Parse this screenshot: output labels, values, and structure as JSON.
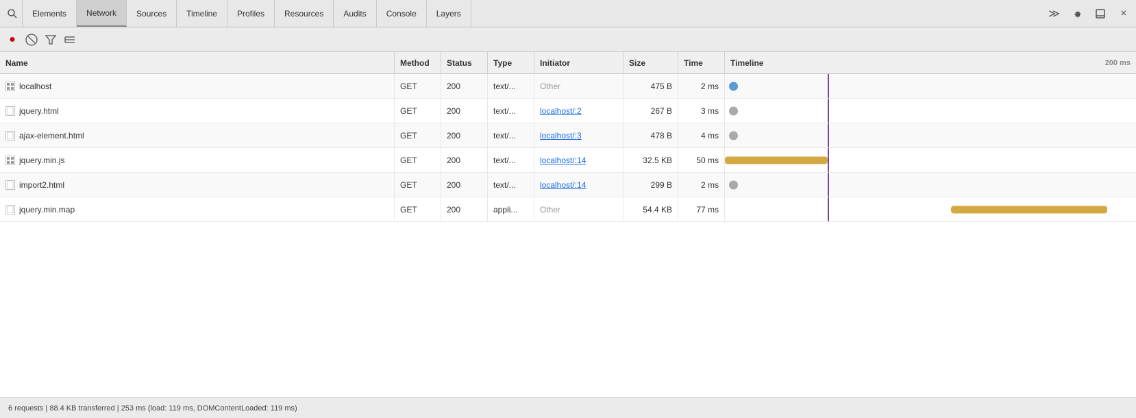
{
  "nav": {
    "tabs": [
      {
        "label": "Elements",
        "active": false
      },
      {
        "label": "Network",
        "active": true
      },
      {
        "label": "Sources",
        "active": false
      },
      {
        "label": "Timeline",
        "active": false
      },
      {
        "label": "Profiles",
        "active": false
      },
      {
        "label": "Resources",
        "active": false
      },
      {
        "label": "Audits",
        "active": false
      },
      {
        "label": "Console",
        "active": false
      },
      {
        "label": "Layers",
        "active": false
      }
    ],
    "right_icons": [
      "≫",
      "⚙",
      "▢",
      "×"
    ]
  },
  "toolbar": {
    "record_label": "●",
    "stop_label": "🚫",
    "filter_label": "▽",
    "list_label": "≡"
  },
  "table": {
    "headers": {
      "name": "Name",
      "method": "Method",
      "status": "Status",
      "type": "Type",
      "initiator": "Initiator",
      "size": "Size",
      "time": "Time",
      "timeline": "Timeline"
    },
    "timeline_label": "200 ms",
    "rows": [
      {
        "icon": "grid",
        "name": "localhost",
        "method": "GET",
        "status": "200",
        "type": "text/...",
        "initiator": "Other",
        "initiator_linked": false,
        "size": "475 B",
        "time": "2 ms",
        "bar_color": "#5b9bd5",
        "bar_left_pct": 0,
        "bar_width_pct": 4,
        "dot_type": "circle",
        "dot_color": "#5b9bd5"
      },
      {
        "icon": "plain",
        "name": "jquery.html",
        "method": "GET",
        "status": "200",
        "type": "text/...",
        "initiator": "localhost/:2",
        "initiator_linked": true,
        "size": "267 B",
        "time": "3 ms",
        "bar_color": "#aaaaaa",
        "bar_left_pct": 0,
        "bar_width_pct": 3,
        "dot_type": "circle",
        "dot_color": "#aaaaaa"
      },
      {
        "icon": "plain",
        "name": "ajax-element.html",
        "method": "GET",
        "status": "200",
        "type": "text/...",
        "initiator": "localhost/:3",
        "initiator_linked": true,
        "size": "478 B",
        "time": "4 ms",
        "bar_color": "#aaaaaa",
        "bar_left_pct": 0,
        "bar_width_pct": 3,
        "dot_type": "circle",
        "dot_color": "#aaaaaa"
      },
      {
        "icon": "grid",
        "name": "jquery.min.js",
        "method": "GET",
        "status": "200",
        "type": "text/...",
        "initiator": "localhost/:14",
        "initiator_linked": true,
        "size": "32.5 KB",
        "time": "50 ms",
        "bar_color": "#d4a843",
        "bar_left_pct": 0,
        "bar_width_pct": 25,
        "dot_type": "pill",
        "dot_color": "#d4a843"
      },
      {
        "icon": "plain",
        "name": "import2.html",
        "method": "GET",
        "status": "200",
        "type": "text/...",
        "initiator": "localhost/:14",
        "initiator_linked": true,
        "size": "299 B",
        "time": "2 ms",
        "bar_color": "#aaaaaa",
        "bar_left_pct": 0,
        "bar_width_pct": 3,
        "dot_type": "circle",
        "dot_color": "#aaaaaa"
      },
      {
        "icon": "plain",
        "name": "jquery.min.map",
        "method": "GET",
        "status": "200",
        "type": "appli...",
        "initiator": "Other",
        "initiator_linked": false,
        "size": "54.4 KB",
        "time": "77 ms",
        "bar_color": "#d4a843",
        "bar_left_pct": 55,
        "bar_width_pct": 38,
        "dot_type": "pill",
        "dot_color": "#d4a843"
      }
    ]
  },
  "status_bar": {
    "text": "6 requests | 88.4 KB transferred | 253 ms (load: 119 ms, DOMContentLoaded: 119 ms)"
  }
}
